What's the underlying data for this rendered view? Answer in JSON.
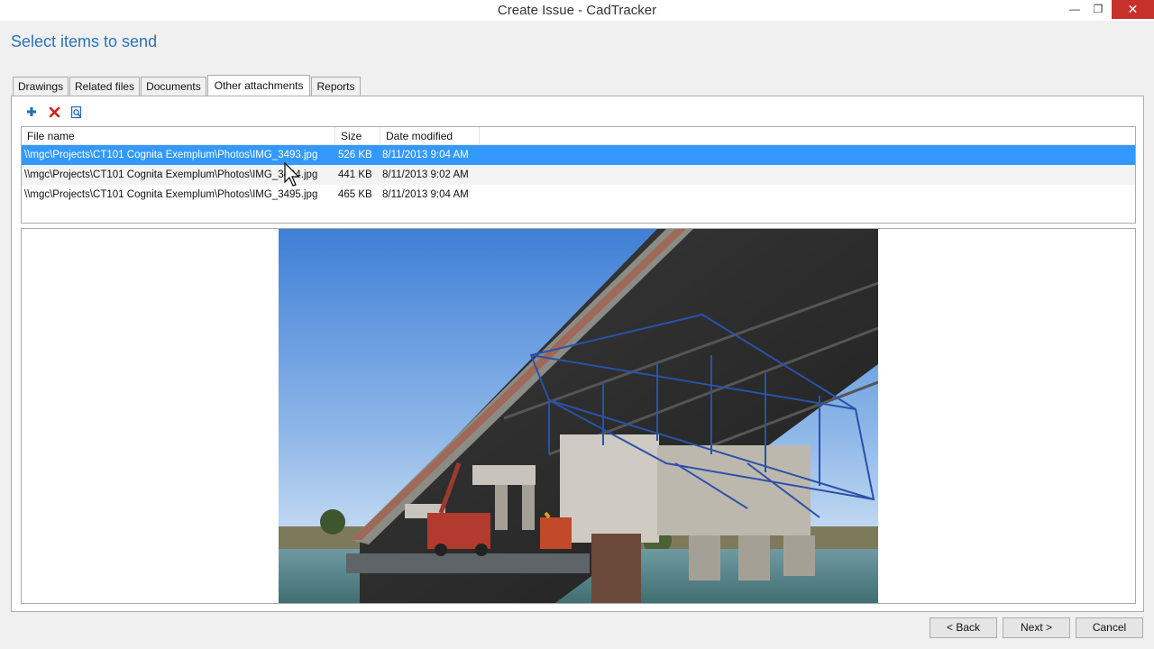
{
  "window": {
    "title": "Create Issue - CadTracker",
    "minimize_label": "—",
    "maximize_label": "❐",
    "close_label": "✕"
  },
  "page_title": "Select items to send",
  "tabs": [
    {
      "label": "Drawings",
      "active": false
    },
    {
      "label": "Related files",
      "active": false
    },
    {
      "label": "Documents",
      "active": false
    },
    {
      "label": "Other attachments",
      "active": true
    },
    {
      "label": "Reports",
      "active": false
    }
  ],
  "toolbar": {
    "icons": [
      "add-icon",
      "delete-icon",
      "preview-icon"
    ]
  },
  "file_list": {
    "columns": [
      "File name",
      "Size",
      "Date modified"
    ],
    "rows": [
      {
        "name": "\\\\mgc\\Projects\\CT101 Cognita Exemplum\\Photos\\IMG_3493.jpg",
        "size": "526 KB",
        "date": "8/11/2013 9:04 AM",
        "selected": true
      },
      {
        "name": "\\\\mgc\\Projects\\CT101 Cognita Exemplum\\Photos\\IMG_3494.jpg",
        "size": "441 KB",
        "date": "8/11/2013 9:02 AM",
        "selected": false
      },
      {
        "name": "\\\\mgc\\Projects\\CT101 Cognita Exemplum\\Photos\\IMG_3495.jpg",
        "size": "465 KB",
        "date": "8/11/2013 9:04 AM",
        "selected": false
      }
    ]
  },
  "buttons": {
    "back": "< Back",
    "next": "Next >",
    "cancel": "Cancel"
  },
  "colors": {
    "accent": "#2b73b8",
    "selection": "#3399ff",
    "close": "#c7312b"
  }
}
